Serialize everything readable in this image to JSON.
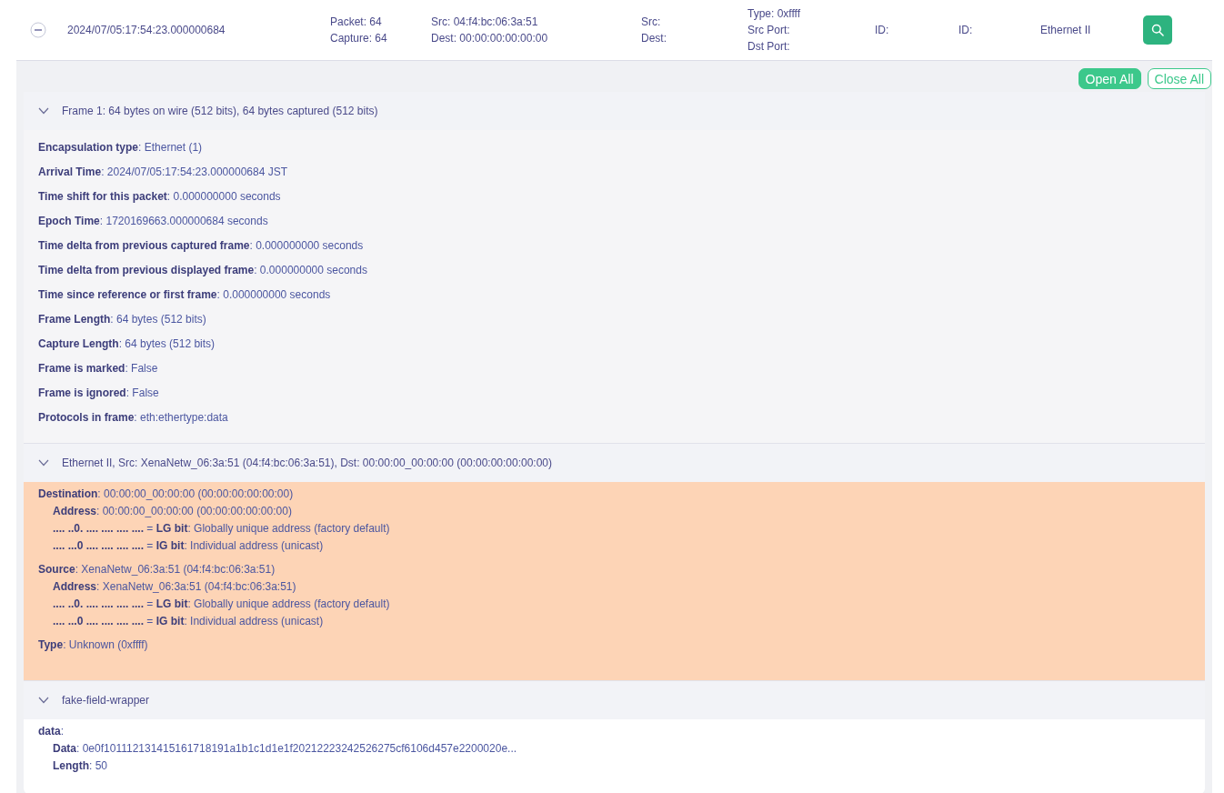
{
  "packet_row": {
    "expanded": true,
    "timestamp": "2024/07/05:17:54:23.000000684",
    "length_lines": [
      "Packet: 64",
      "Capture: 64"
    ],
    "mac_lines": [
      "Src: 04:f4:bc:06:3a:51",
      "Dest: 00:00:00:00:00:00"
    ],
    "ip_lines": [
      "Src:",
      "Dest:"
    ],
    "port_lines": [
      "Type: 0xffff",
      "Src Port:",
      "Dst Port:"
    ],
    "id_1": "ID:",
    "id_2": "ID:",
    "protocol": "Ethernet II"
  },
  "toolbar": [
    {
      "label": "Open All",
      "kind": "primary"
    },
    {
      "label": "Close All",
      "kind": "outline"
    }
  ],
  "sections": [
    {
      "title": "Frame 1: 64 bytes on wire (512 bits), 64 bytes captured (512 bits)",
      "expanded": true,
      "kind": "spaced",
      "highlighted": false,
      "groups": [
        {
          "lines": [
            "**Encapsulation type**: Ethernet (1)"
          ]
        },
        {
          "lines": [
            "**Arrival Time**: 2024/07/05:17:54:23.000000684 JST"
          ]
        },
        {
          "lines": [
            "**Time shift for this packet**: 0.000000000 seconds"
          ]
        },
        {
          "lines": [
            "**Epoch Time**: 1720169663.000000684 seconds"
          ]
        },
        {
          "lines": [
            "**Time delta from previous captured frame**: 0.000000000 seconds"
          ]
        },
        {
          "lines": [
            "**Time delta from previous displayed frame**: 0.000000000 seconds"
          ]
        },
        {
          "lines": [
            "**Time since reference or first frame**: 0.000000000 seconds"
          ]
        },
        {
          "lines": [
            "**Frame Length**: 64 bytes (512 bits)"
          ]
        },
        {
          "lines": [
            "**Capture Length**: 64 bytes (512 bits)"
          ]
        },
        {
          "lines": [
            "**Frame is marked**: False"
          ]
        },
        {
          "lines": [
            "**Frame is ignored**: False"
          ]
        },
        {
          "lines": [
            "**Protocols in frame**: eth:ethertype:data"
          ]
        }
      ]
    },
    {
      "title": "Ethernet II, Src: XenaNetw_06:3a:51 (04:f4:bc:06:3a:51), Dst: 00:00:00_00:00:00 (00:00:00:00:00:00)",
      "expanded": true,
      "kind": "grouped",
      "highlighted": true,
      "groups": [
        {
          "lines": [
            "**Destination**: 00:00:00_00:00:00 (00:00:00:00:00:00)"
          ],
          "children": [
            "**Address**: 00:00:00_00:00:00 (00:00:00:00:00:00)",
            "**.... ..0. .... .... .... ....** = **LG bit**: Globally unique address (factory default)",
            "**.... ...0 .... .... .... ....** = **IG bit**: Individual address (unicast)"
          ]
        },
        {
          "lines": [
            "**Source**: XenaNetw_06:3a:51 (04:f4:bc:06:3a:51)"
          ],
          "children": [
            "**Address**: XenaNetw_06:3a:51 (04:f4:bc:06:3a:51)",
            "**.... ..0. .... .... .... ....** = **LG bit**: Globally unique address (factory default)",
            "**.... ...0 .... .... .... ....** = **IG bit**: Individual address (unicast)"
          ]
        },
        {
          "lines": [
            "**Type**: Unknown (0xffff)"
          ]
        }
      ]
    },
    {
      "title": "fake-field-wrapper",
      "expanded": true,
      "kind": "grouped",
      "highlighted": false,
      "groups": [
        {
          "lines": [
            "**data**:"
          ],
          "children": [
            "**Data**: 0e0f101112131415161718191a1b1c1d1e1f20212223242526275cf6106d457e2200020e...",
            "**Length**: 50"
          ]
        }
      ]
    }
  ]
}
